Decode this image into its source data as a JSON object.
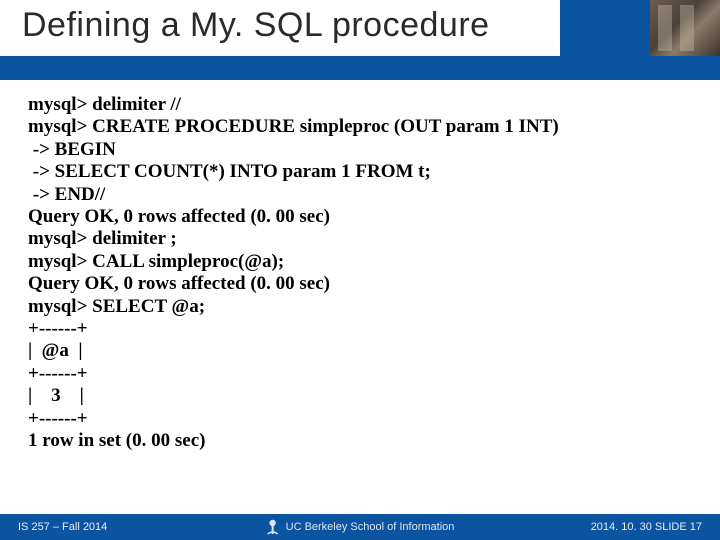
{
  "title": "Defining a My. SQL procedure",
  "code_lines": [
    "mysql> delimiter //",
    "mysql> CREATE PROCEDURE simpleproc (OUT param 1 INT)",
    " -> BEGIN",
    " -> SELECT COUNT(*) INTO param 1 FROM t;",
    " -> END//",
    "Query OK, 0 rows affected (0. 00 sec)",
    "mysql> delimiter ;",
    "mysql> CALL simpleproc(@a);",
    "Query OK, 0 rows affected (0. 00 sec)",
    "mysql> SELECT @a;",
    "+------+",
    "|  @a  |",
    "+------+",
    "|    3    |",
    "+------+",
    "1 row in set (0. 00 sec)"
  ],
  "footer": {
    "left": "IS 257 – Fall 2014",
    "center": "UC Berkeley School of Information",
    "right": "2014. 10. 30 SLIDE 17"
  }
}
